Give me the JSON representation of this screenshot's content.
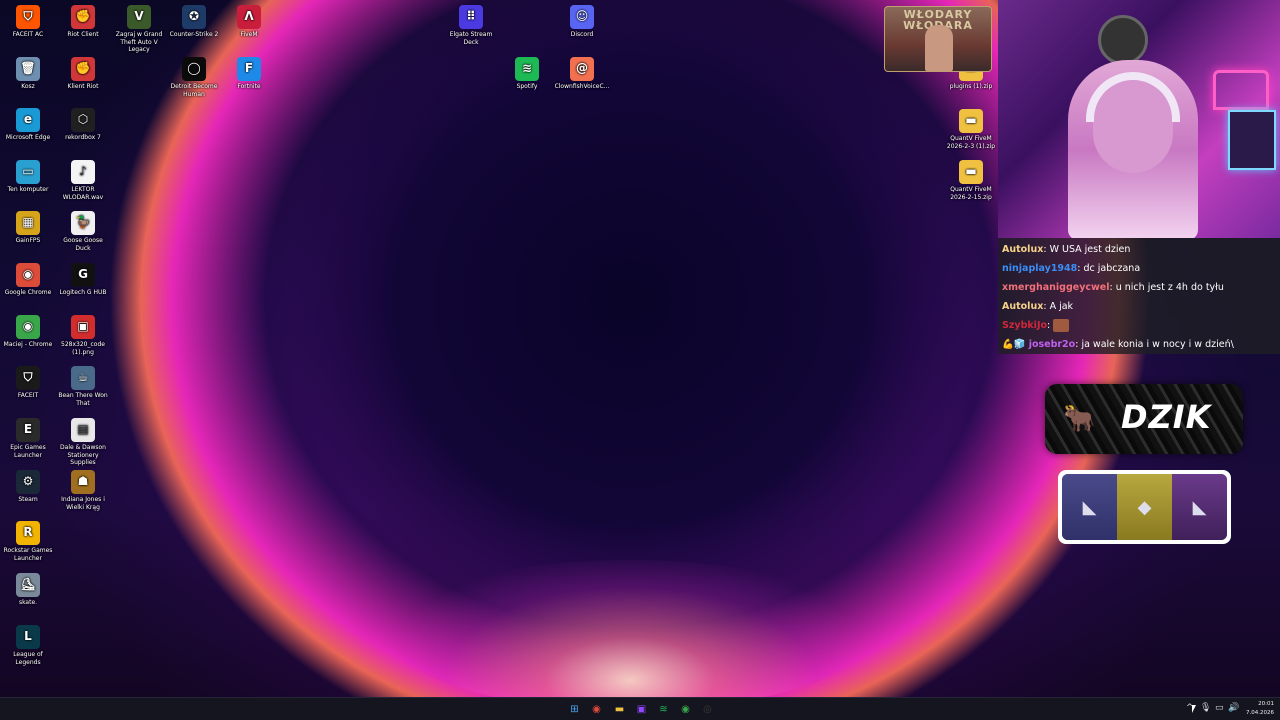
{
  "desktop": {
    "icons": [
      {
        "label": "FACEIT AC",
        "icon": "faceit-ac-icon",
        "color": "#ff5500",
        "glyph": "⛉"
      },
      {
        "label": "Riot Client",
        "icon": "riot-client-icon",
        "color": "#d13639",
        "glyph": "✊"
      },
      {
        "label": "Zagraj w Grand Theft Auto V Legacy",
        "icon": "gta-v-icon",
        "color": "#3a5a2a",
        "glyph": "V"
      },
      {
        "label": "Counter-Strike 2",
        "icon": "counter-strike-icon",
        "color": "#1e3a66",
        "glyph": "✪"
      },
      {
        "label": "FiveM",
        "icon": "fivem-icon",
        "color": "#c81e3c",
        "glyph": "Λ"
      },
      {
        "label": "Kosz",
        "icon": "recycle-bin-icon",
        "color": "#6e8fb0",
        "glyph": "🗑"
      },
      {
        "label": "Klient Riot",
        "icon": "riot-client-icon",
        "color": "#d13639",
        "glyph": "✊"
      },
      {
        "label": "Detroit Become Human",
        "icon": "detroit-icon",
        "color": "#0b0b0b",
        "glyph": "◯"
      },
      {
        "label": "Fortnite",
        "icon": "fortnite-icon",
        "color": "#1e8ae8",
        "glyph": "F"
      },
      {
        "label": "Microsoft Edge",
        "icon": "edge-icon",
        "color": "#1a9ad4",
        "glyph": "e"
      },
      {
        "label": "rekordbox 7",
        "icon": "rekordbox-icon",
        "color": "#202020",
        "glyph": "⬡"
      },
      {
        "label": "Ten komputer",
        "icon": "this-pc-icon",
        "color": "#2aa0d0",
        "glyph": "▭"
      },
      {
        "label": "LEKTOR WLODAR.wav",
        "icon": "wav-file-icon",
        "color": "#f4f4f4",
        "glyph": "♪"
      },
      {
        "label": "GainFPS",
        "icon": "gainfps-icon",
        "color": "#d6a41a",
        "glyph": "▦"
      },
      {
        "label": "Goose Goose Duck",
        "icon": "goose-icon",
        "color": "#f0f0f0",
        "glyph": "🦆"
      },
      {
        "label": "Google Chrome",
        "icon": "chrome-icon",
        "color": "#dd4b39",
        "glyph": "◉"
      },
      {
        "label": "Logitech G HUB",
        "icon": "logitech-icon",
        "color": "#111111",
        "glyph": "G"
      },
      {
        "label": "Maciej - Chrome",
        "icon": "chrome-icon",
        "color": "#3aa64a",
        "glyph": "◉"
      },
      {
        "label": "528x320_code (1).png",
        "icon": "image-file-icon",
        "color": "#d12d2d",
        "glyph": "▣"
      },
      {
        "label": "FACEIT",
        "icon": "faceit-icon",
        "color": "#1a1a1a",
        "glyph": "⛉"
      },
      {
        "label": "Bean There Won That",
        "icon": "game-icon",
        "color": "#4a6a8a",
        "glyph": "☕"
      },
      {
        "label": "Epic Games Launcher",
        "icon": "epic-games-icon",
        "color": "#2a2a2a",
        "glyph": "E"
      },
      {
        "label": "Dale & Dawson Stationery Supplies",
        "icon": "dale-dawson-icon",
        "color": "#e8e8e8",
        "glyph": "▤"
      },
      {
        "label": "Steam",
        "icon": "steam-icon",
        "color": "#1b2838",
        "glyph": "⚙"
      },
      {
        "label": "Indiana Jones i Wielki Krąg",
        "icon": "indiana-jones-icon",
        "color": "#a07020",
        "glyph": "☗"
      },
      {
        "label": "Rockstar Games Launcher",
        "icon": "rockstar-icon",
        "color": "#f2b400",
        "glyph": "R"
      },
      {
        "label": "skate.",
        "icon": "skate-icon",
        "color": "#7a8a9a",
        "glyph": "⛸"
      },
      {
        "label": "League of Legends",
        "icon": "league-icon",
        "color": "#0a3a4a",
        "glyph": "L"
      },
      {
        "label": "Elgato Stream Deck",
        "icon": "stream-deck-icon",
        "color": "#4a3ae0",
        "glyph": "⠿"
      },
      {
        "label": "Discord",
        "icon": "discord-icon",
        "color": "#5865f2",
        "glyph": "☺"
      },
      {
        "label": "Spotify",
        "icon": "spotify-icon",
        "color": "#1db954",
        "glyph": "≋"
      },
      {
        "label": "ClownfishVoiceC...",
        "icon": "clownfish-icon",
        "color": "#f07050",
        "glyph": "@"
      },
      {
        "label": "plugins (1).zip",
        "icon": "zip-folder-icon",
        "color": "#f0c040",
        "glyph": "▬"
      },
      {
        "label": "QuantV FiveM 2026-2-3 (1).zip",
        "icon": "zip-folder-icon",
        "color": "#f0c040",
        "glyph": "▬"
      },
      {
        "label": "QuantV FiveM 2026-2-15.zip",
        "icon": "zip-folder-icon",
        "color": "#f0c040",
        "glyph": "▬"
      }
    ]
  },
  "overlay": {
    "avatar_title": "WŁODARY WŁODARA",
    "chat": [
      {
        "user": "Autolux",
        "user_color": "#f6d28a",
        "text": "W USA jest dzien"
      },
      {
        "user": "ninjaplay1948",
        "user_color": "#3a8ef6",
        "text": "dc jabczana"
      },
      {
        "user": "xmerghaniggeycwel",
        "user_color": "#f2707a",
        "text": "u nich jest z 4h do tyłu"
      },
      {
        "user": "Autolux",
        "user_color": "#f6d28a",
        "text": "A jak"
      },
      {
        "user": "SzybkiJo",
        "user_color": "#d0283a",
        "text": ""
      },
      {
        "user": "josebr2o",
        "user_color": "#c060f0",
        "text": "ja wale konia i w nocy i w dzień\\"
      }
    ],
    "dzik_label": "DZIK",
    "case_items": [
      "◣",
      "◆",
      "◣"
    ]
  },
  "taskbar": {
    "apps": [
      {
        "name": "start-button",
        "glyph": "⊞",
        "color": "#4aa8f0"
      },
      {
        "name": "chrome-taskbar",
        "glyph": "◉",
        "color": "#dd4b39"
      },
      {
        "name": "file-explorer-taskbar",
        "glyph": "▬",
        "color": "#f0c040"
      },
      {
        "name": "twitch-taskbar",
        "glyph": "▣",
        "color": "#9146ff"
      },
      {
        "name": "spotify-taskbar",
        "glyph": "≋",
        "color": "#1db954"
      },
      {
        "name": "chrome-profile-taskbar",
        "glyph": "◉",
        "color": "#3aa64a"
      },
      {
        "name": "obs-taskbar",
        "glyph": "◎",
        "color": "#3a3a3a"
      }
    ],
    "clock_time": "20:01",
    "clock_date": "7.04.2026"
  }
}
